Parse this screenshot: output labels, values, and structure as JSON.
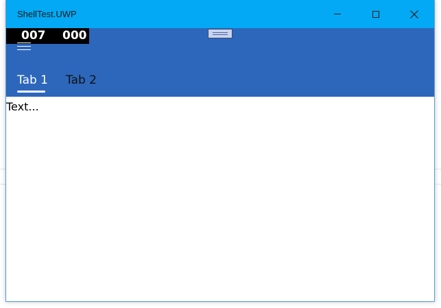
{
  "window": {
    "title": "ShellTest.UWP"
  },
  "titlebar_buttons": {
    "minimize": "minimize",
    "maximize": "maximize",
    "close": "close"
  },
  "counter": {
    "first": "007",
    "second": "000"
  },
  "tabs": [
    {
      "label": "Tab 1",
      "selected": true
    },
    {
      "label": "Tab 2",
      "selected": false
    }
  ],
  "content": {
    "text": "Text..."
  },
  "colors": {
    "titlebar": "#03a9f4",
    "header": "#2d67bb",
    "counter_bg": "#000000",
    "content_bg": "#ffffff"
  },
  "icons": {
    "menu": "hamburger-icon",
    "drag": "drag-handle-icon",
    "close": "close-icon",
    "maximize": "maximize-icon",
    "minimize": "minimize-icon"
  }
}
